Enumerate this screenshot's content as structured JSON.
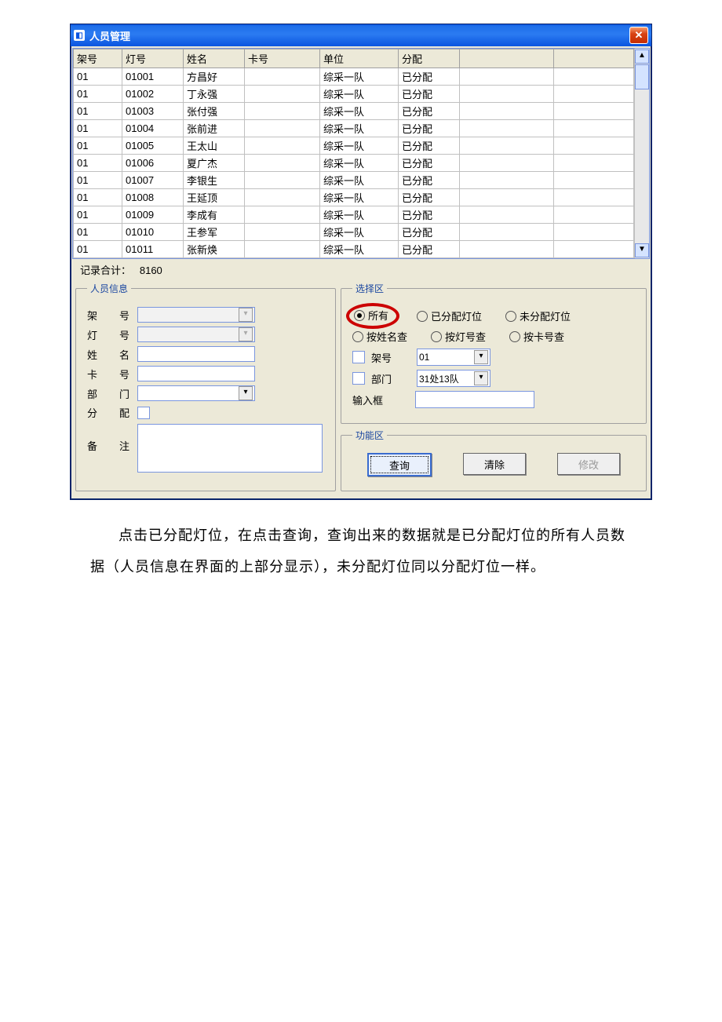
{
  "window": {
    "title": "人员管理"
  },
  "grid": {
    "headers": [
      "架号",
      "灯号",
      "姓名",
      "卡号",
      "单位",
      "分配",
      "",
      ""
    ],
    "rows": [
      [
        "01",
        "01001",
        "方昌好",
        "",
        "综采一队",
        "已分配",
        "",
        ""
      ],
      [
        "01",
        "01002",
        "丁永强",
        "",
        "综采一队",
        "已分配",
        "",
        ""
      ],
      [
        "01",
        "01003",
        "张付强",
        "",
        "综采一队",
        "已分配",
        "",
        ""
      ],
      [
        "01",
        "01004",
        "张前进",
        "",
        "综采一队",
        "已分配",
        "",
        ""
      ],
      [
        "01",
        "01005",
        "王太山",
        "",
        "综采一队",
        "已分配",
        "",
        ""
      ],
      [
        "01",
        "01006",
        "夏广杰",
        "",
        "综采一队",
        "已分配",
        "",
        ""
      ],
      [
        "01",
        "01007",
        "李银生",
        "",
        "综采一队",
        "已分配",
        "",
        ""
      ],
      [
        "01",
        "01008",
        "王延顶",
        "",
        "综采一队",
        "已分配",
        "",
        ""
      ],
      [
        "01",
        "01009",
        "李成有",
        "",
        "综采一队",
        "已分配",
        "",
        ""
      ],
      [
        "01",
        "01010",
        "王参军",
        "",
        "综采一队",
        "已分配",
        "",
        ""
      ],
      [
        "01",
        "01011",
        "张新焕",
        "",
        "综采一队",
        "已分配",
        "",
        ""
      ]
    ]
  },
  "record_total": {
    "label": "记录合计：",
    "value": "8160"
  },
  "person": {
    "legend": "人员信息",
    "rack": "架 号",
    "lamp": "灯 号",
    "name": "姓 名",
    "card": "卡 号",
    "dept": "部 门",
    "alloc": "分 配",
    "memo": "备 注"
  },
  "select": {
    "legend": "选择区",
    "r_all": "所有",
    "r_assigned": "已分配灯位",
    "r_unassigned": "未分配灯位",
    "r_byname": "按姓名查",
    "r_bylamp": "按灯号查",
    "r_bycard": "按卡号查",
    "chk_rack": "架号",
    "chk_dept": "部门",
    "rack_val": "01",
    "dept_val": "31处13队",
    "input_label": "输入框"
  },
  "func": {
    "legend": "功能区",
    "query": "查询",
    "clear": "清除",
    "modify": "修改"
  },
  "caption": "点击已分配灯位，在点击查询，查询出来的数据就是已分配灯位的所有人员数据（人员信息在界面的上部分显示），未分配灯位同以分配灯位一样。"
}
